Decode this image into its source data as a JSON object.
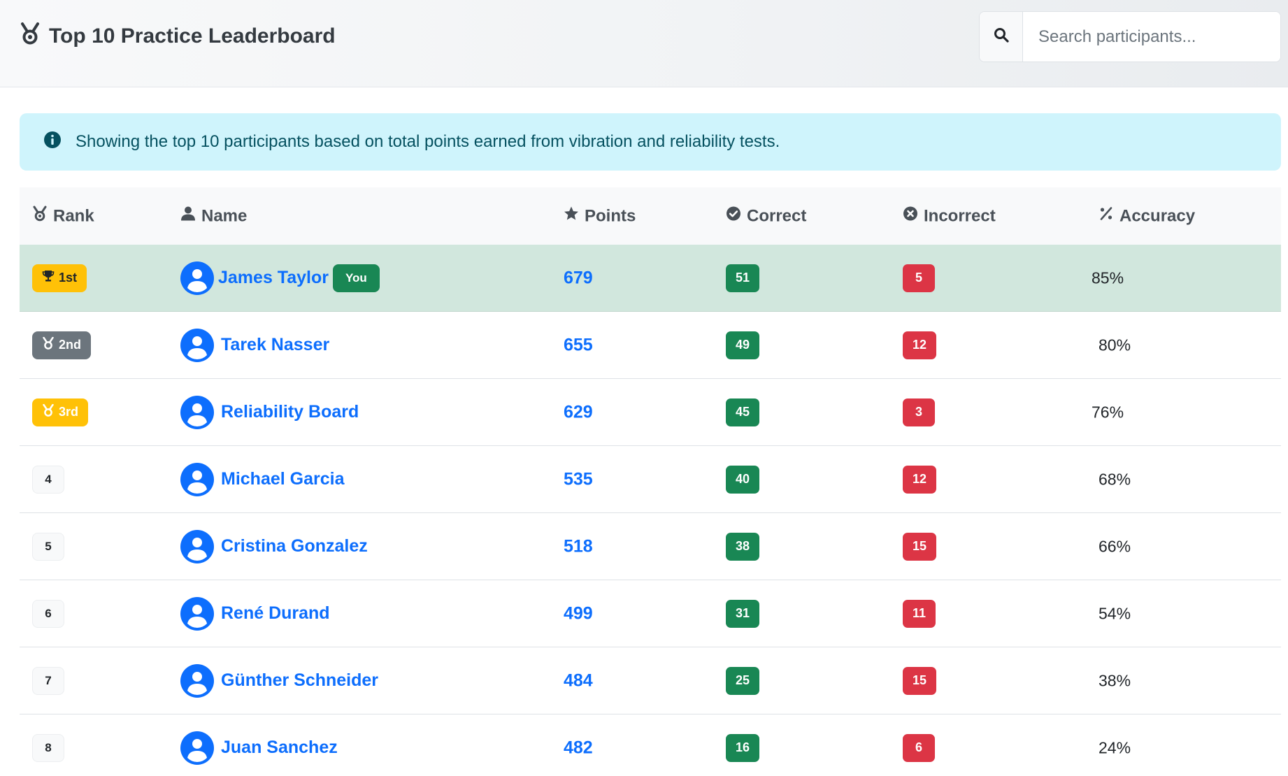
{
  "header": {
    "title": "Top 10 Practice Leaderboard",
    "title_icon": "medal-icon",
    "search": {
      "placeholder": "Search participants...",
      "value": ""
    }
  },
  "alert": {
    "icon": "info-circle-icon",
    "text": "Showing the top 10 participants based on total points earned from vibration and reliability tests."
  },
  "table": {
    "columns": [
      {
        "label": "Rank",
        "icon": "medal-icon"
      },
      {
        "label": "Name",
        "icon": "user-icon"
      },
      {
        "label": "Points",
        "icon": "star-icon"
      },
      {
        "label": "Correct",
        "icon": "check-circle-icon"
      },
      {
        "label": "Incorrect",
        "icon": "x-circle-icon"
      },
      {
        "label": "Accuracy",
        "icon": "percent-icon"
      }
    ],
    "rows": [
      {
        "rank": "1st",
        "name": "James Taylor",
        "you": "You",
        "points": "679",
        "correct": "51",
        "incorrect": "5",
        "accuracy": "85%"
      },
      {
        "rank": "2nd",
        "name": "Tarek Nasser",
        "points": "655",
        "correct": "49",
        "incorrect": "12",
        "accuracy": "80%"
      },
      {
        "rank": "3rd",
        "name": "Reliability Board",
        "points": "629",
        "correct": "45",
        "incorrect": "3",
        "accuracy": "76%"
      },
      {
        "rank": "4",
        "name": "Michael Garcia",
        "points": "535",
        "correct": "40",
        "incorrect": "12",
        "accuracy": "68%"
      },
      {
        "rank": "5",
        "name": "Cristina Gonzalez",
        "points": "518",
        "correct": "38",
        "incorrect": "15",
        "accuracy": "66%"
      },
      {
        "rank": "6",
        "name": "René Durand",
        "points": "499",
        "correct": "31",
        "incorrect": "11",
        "accuracy": "54%"
      },
      {
        "rank": "7",
        "name": "Günther Schneider",
        "points": "484",
        "correct": "25",
        "incorrect": "15",
        "accuracy": "38%"
      },
      {
        "rank": "8",
        "name": "Juan Sanchez",
        "points": "482",
        "correct": "16",
        "incorrect": "6",
        "accuracy": "24%"
      }
    ]
  },
  "colors": {
    "highlight_row": "#d1e7dd",
    "link": "#0d6efd",
    "success": "#198754",
    "danger": "#dc3545",
    "warning": "#ffc107",
    "secondary": "#6c757d",
    "info_bg": "#cff4fc"
  }
}
